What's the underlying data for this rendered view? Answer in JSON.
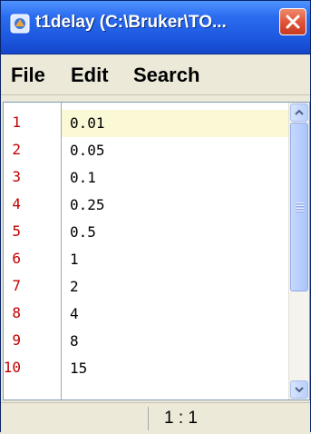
{
  "window": {
    "title": "t1delay (C:\\Bruker\\TO...",
    "close_icon": "close-icon"
  },
  "menu": {
    "items": [
      "File",
      "Edit",
      "Search"
    ]
  },
  "editor": {
    "line_numbers": [
      "1",
      "2",
      "3",
      "4",
      "5",
      "6",
      "7",
      "8",
      "9",
      "10"
    ],
    "lines": [
      "0.01",
      "0.05",
      "0.1",
      "0.25",
      "0.5",
      "1",
      "2",
      "4",
      "8",
      "15"
    ],
    "current_line_color": "#fbf8d6",
    "line_number_color": "#c20000"
  },
  "status": {
    "cursor_position": "1 : 1"
  }
}
